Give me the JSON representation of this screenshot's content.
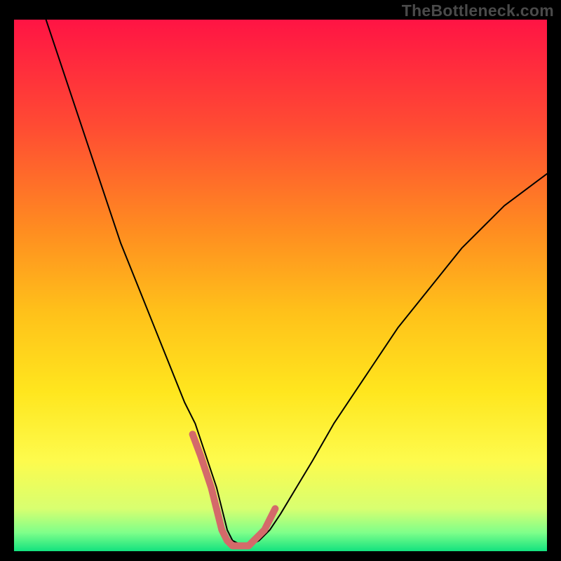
{
  "watermark": "TheBottleneck.com",
  "chart_data": {
    "type": "line",
    "title": "",
    "xlabel": "",
    "ylabel": "",
    "xlim": [
      0,
      100
    ],
    "ylim": [
      0,
      100
    ],
    "grid": false,
    "legend": false,
    "background_gradient": {
      "direction": "vertical",
      "stops": [
        {
          "pos": 0.0,
          "color": "#ff1444"
        },
        {
          "pos": 0.2,
          "color": "#ff4b33"
        },
        {
          "pos": 0.4,
          "color": "#ff8e20"
        },
        {
          "pos": 0.55,
          "color": "#ffc11a"
        },
        {
          "pos": 0.7,
          "color": "#ffe61e"
        },
        {
          "pos": 0.83,
          "color": "#fdfb4d"
        },
        {
          "pos": 0.92,
          "color": "#d8ff70"
        },
        {
          "pos": 0.965,
          "color": "#7fff8a"
        },
        {
          "pos": 1.0,
          "color": "#13e27f"
        }
      ]
    },
    "series": [
      {
        "name": "curve-black",
        "type": "line",
        "stroke": "#000000",
        "stroke_width": 2,
        "x": [
          6,
          8,
          10,
          12,
          14,
          16,
          18,
          20,
          22,
          24,
          26,
          28,
          30,
          32,
          34,
          36,
          37,
          38,
          39,
          40,
          41,
          43,
          44,
          46,
          48,
          50,
          53,
          56,
          60,
          64,
          68,
          72,
          76,
          80,
          84,
          88,
          92,
          96,
          100
        ],
        "values": [
          100,
          94,
          88,
          82,
          76,
          70,
          64,
          58,
          53,
          48,
          43,
          38,
          33,
          28,
          24,
          18,
          15,
          12,
          8,
          4,
          2,
          1,
          1,
          2,
          4,
          7,
          12,
          17,
          24,
          30,
          36,
          42,
          47,
          52,
          57,
          61,
          65,
          68,
          71
        ]
      },
      {
        "name": "highlight-pink",
        "type": "line",
        "stroke": "#d46a6a",
        "stroke_width": 10,
        "x": [
          33.5,
          35,
          36,
          37,
          38,
          39,
          40,
          41,
          42,
          43,
          44,
          45,
          46,
          47,
          48,
          49
        ],
        "values": [
          22,
          18,
          15,
          12,
          8,
          4,
          2,
          1,
          1,
          1,
          1,
          2,
          3,
          4,
          6,
          8
        ]
      }
    ]
  }
}
